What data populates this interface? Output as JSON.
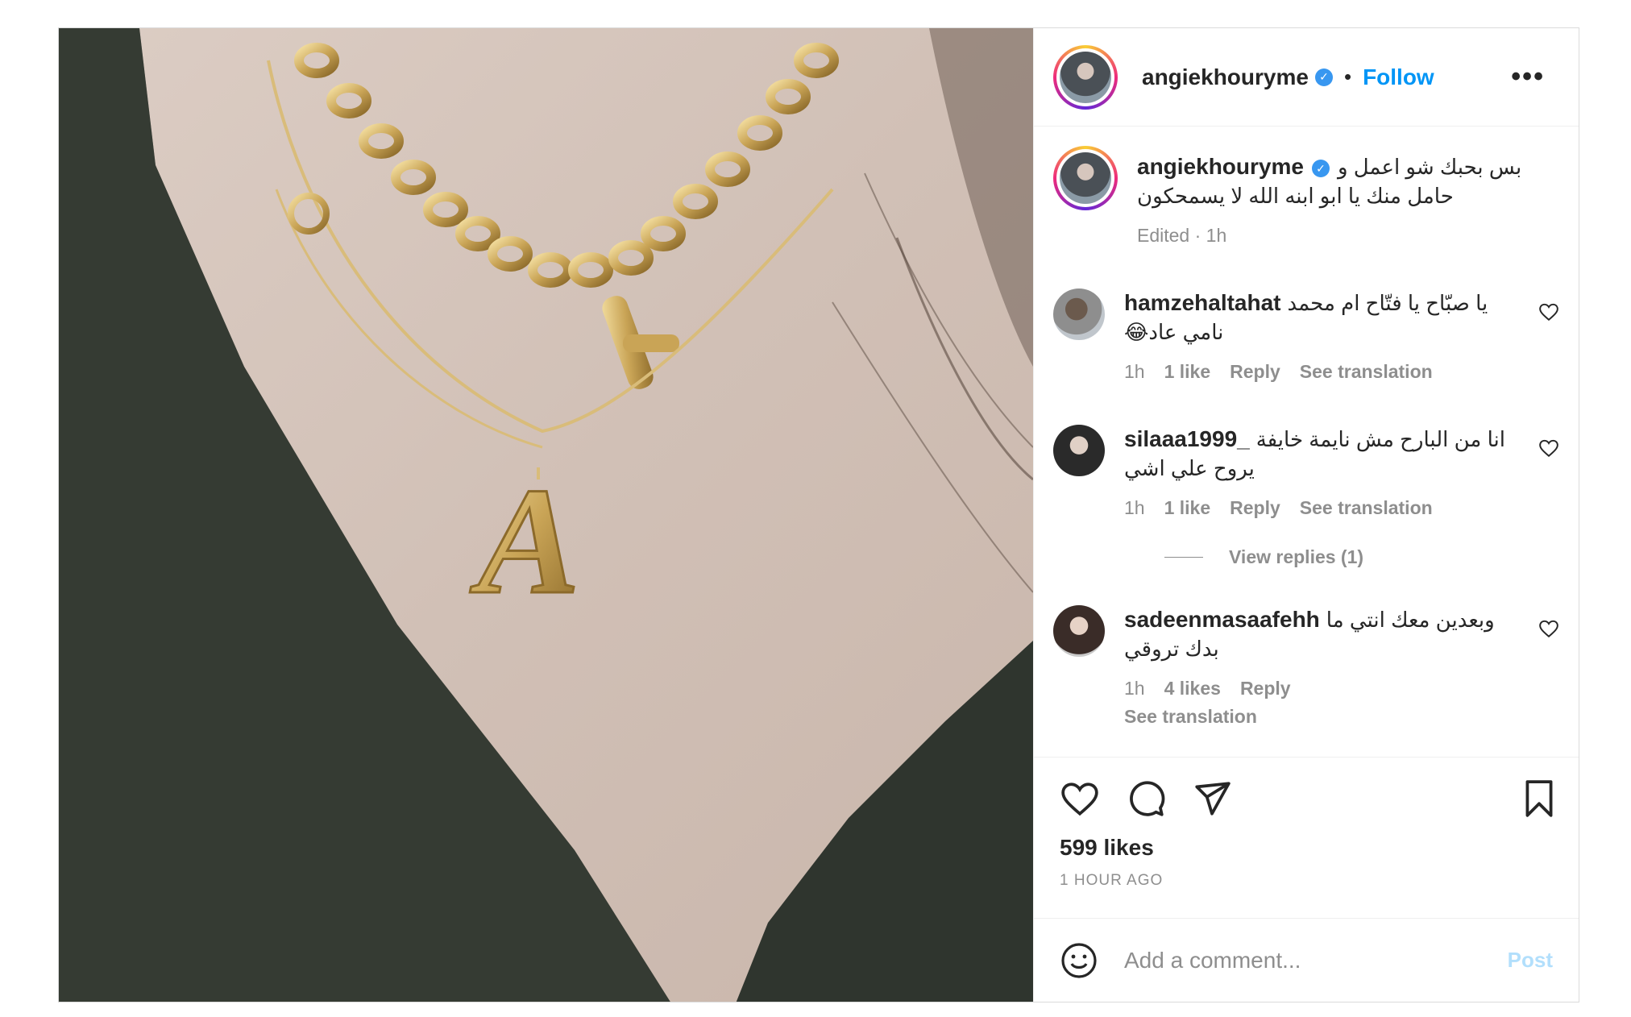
{
  "header": {
    "username": "angiekhouryme",
    "verified_icon": "✓",
    "separator": "•",
    "follow_label": "Follow",
    "more_label": "•••"
  },
  "caption": {
    "username": "angiekhouryme",
    "text_line1": "بس بحبك شو اعمل و",
    "text_line2": "حامل منك يا ابو ابنه الله لا يسمحكون",
    "meta": "Edited · 1h"
  },
  "comments": [
    {
      "username": "hamzehaltahat",
      "text_line1": "يا صبّاح يا فتّاح ام محمد",
      "text_line2": "نامي عاد😂",
      "time": "1h",
      "likes": "1 like",
      "reply": "Reply",
      "translate": "See translation"
    },
    {
      "username": "silaaa1999_",
      "text_line1": "انا من البارح مش نايمة خايفة",
      "text_line2": "يروح علي اشي",
      "time": "1h",
      "likes": "1 like",
      "reply": "Reply",
      "translate": "See translation",
      "view_replies": "View replies (1)"
    },
    {
      "username": "sadeenmasaafehh",
      "text_line1": "وبعدين معك انتي ما",
      "text_line2": "بدك تروقي",
      "time": "1h",
      "likes": "4 likes",
      "reply": "Reply",
      "translate": "See translation"
    }
  ],
  "actions": {
    "likes_count": "599 likes",
    "time_ago": "1 HOUR AGO"
  },
  "add_comment": {
    "placeholder": "Add a comment...",
    "post_label": "Post"
  },
  "colors": {
    "accent": "#0095f6",
    "verified": "#3897f0",
    "muted": "#8e8e8e",
    "post_disabled": "#b2dffc"
  },
  "icons": [
    "heart-icon",
    "comment-icon",
    "share-icon",
    "bookmark-icon",
    "emoji-icon",
    "more-icon",
    "verified-icon"
  ]
}
